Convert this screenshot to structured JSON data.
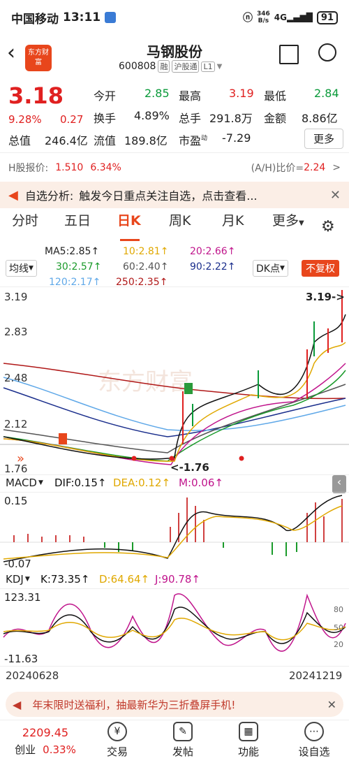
{
  "status": {
    "carrier": "中国移动",
    "time": "13:11",
    "speed_top": "346",
    "speed_unit": "B/s",
    "battery": "91"
  },
  "header": {
    "title": "马钢股份",
    "code": "600808",
    "tag_rong": "融",
    "tag_hgt": "沪股通",
    "tag_l1": "L1",
    "logo_text": "东方财富"
  },
  "quote": {
    "price": "3.18",
    "pct": "9.28%",
    "chg": "0.27",
    "open_label": "今开",
    "open": "2.85",
    "high_label": "最高",
    "high": "3.19",
    "low_label": "最低",
    "low": "2.84",
    "turn_label": "换手",
    "turn": "4.89%",
    "vol_label": "总手",
    "vol": "291.8万",
    "amt_label": "金额",
    "amt": "8.86亿",
    "mcap_label": "总值",
    "mcap": "246.4亿",
    "float_label": "流值",
    "float": "189.8亿",
    "pe_label": "市盈",
    "pe_sup": "动",
    "pe": "-7.29",
    "more": "更多"
  },
  "hshare": {
    "label": "H股报价:",
    "price": "1.510",
    "pct": "6.34%",
    "ah_label": "(A/H)比价=",
    "ah": "2.24",
    "arrow": ">"
  },
  "notice": {
    "label": "自选分析:",
    "text": "触发今日重点关注自选，点击查看..."
  },
  "tabs": [
    "分时",
    "五日",
    "日K",
    "周K",
    "月K",
    "更多"
  ],
  "active_tab": "日K",
  "ma": {
    "selector": "均线",
    "ma5": "MA5:2.85↑",
    "ma10": "10:2.81↑",
    "ma20": "20:2.66↑",
    "ma30": "30:2.57↑",
    "ma60": "60:2.40↑",
    "ma90": "90:2.22↑",
    "ma120": "120:2.17↑",
    "ma250": "250:2.35↑",
    "dk": "DK点",
    "adjust": "不复权"
  },
  "kchart": {
    "y_top": "3.19",
    "y2": "2.83",
    "y3": "2.48",
    "y4": "2.12",
    "y_bottom": "1.76",
    "high_mark": "3.19->",
    "low_mark": "<-1.76",
    "watermark": "东方财富"
  },
  "macd": {
    "name": "MACD",
    "dif": "DIF:0.15↑",
    "dea": "DEA:0.12↑",
    "m": "M:0.06↑",
    "top": "0.15",
    "bottom": "-0.07"
  },
  "kdj": {
    "name": "KDJ",
    "k": "K:73.35↑",
    "d": "D:64.64↑",
    "j": "J:90.78↑",
    "top": "123.31",
    "bottom": "-11.63",
    "r80": "80",
    "r50": "50",
    "r20": "20"
  },
  "dates": {
    "start": "20240628",
    "end": "20241219"
  },
  "promo": {
    "text": "年末限时送福利，抽最新华为三折叠屏手机!"
  },
  "bottom_nav": {
    "index_value": "2209.45",
    "index_name": "创业",
    "index_pct": "0.33%",
    "trade": "交易",
    "post": "发帖",
    "func": "功能",
    "settings": "设自选"
  }
}
